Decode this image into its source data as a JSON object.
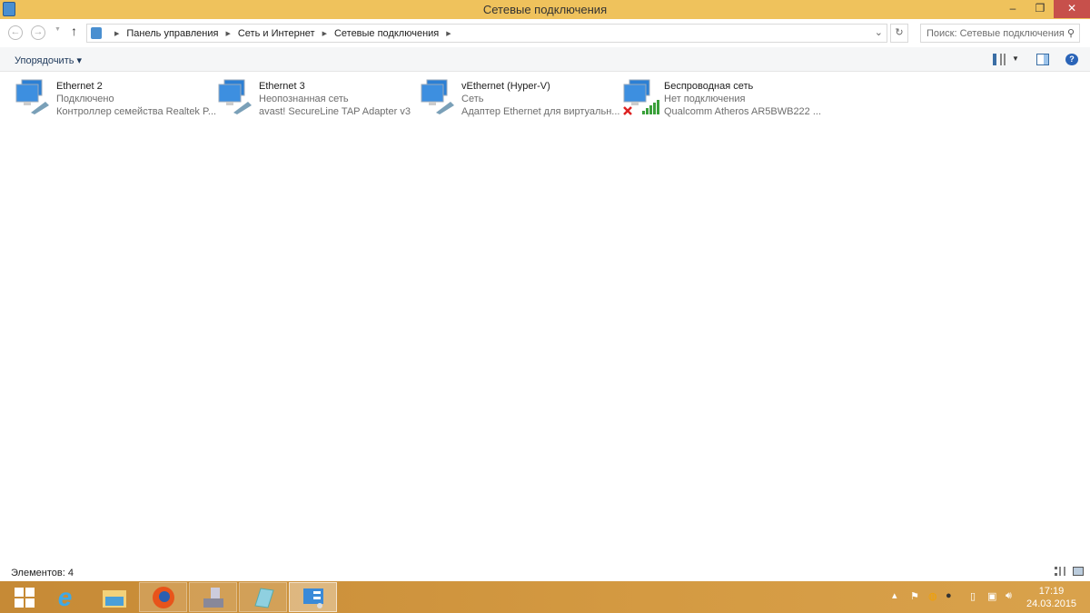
{
  "window": {
    "title": "Сетевые подключения",
    "minimize": "–",
    "maximize": "❐",
    "close": "✕"
  },
  "address": {
    "back": "←",
    "forward": "→",
    "up": "↑",
    "breadcrumb": [
      "Панель управления",
      "Сеть и Интернет",
      "Сетевые подключения"
    ],
    "search_placeholder": "Поиск: Сетевые подключения"
  },
  "toolbar": {
    "organize": "Упорядочить ▾"
  },
  "connections": [
    {
      "name": "Ethernet 2",
      "status": "Подключено",
      "adapter": "Контроллер семейства Realtek P...",
      "type": "wired"
    },
    {
      "name": "Ethernet 3",
      "status": "Неопознанная сеть",
      "adapter": "avast! SecureLine TAP Adapter v3",
      "type": "wired"
    },
    {
      "name": "vEthernet (Hyper-V)",
      "status": "Сеть",
      "adapter": "Адаптер Ethernet для виртуальн...",
      "type": "wired"
    },
    {
      "name": "Беспроводная сеть",
      "status": "Нет подключения",
      "adapter": "Qualcomm Atheros AR5BWB222 ...",
      "type": "wireless",
      "disconnected": true
    }
  ],
  "statusbar": {
    "count": "Элементов: 4"
  },
  "taskbar": {
    "apps": [
      "start",
      "internet-explorer",
      "file-explorer",
      "firefox",
      "device-manager",
      "notepad",
      "network-control-panel"
    ],
    "time": "17:19",
    "date": "24.03.2015"
  },
  "colors": {
    "titlebar": "#efc25c",
    "close": "#c7504b",
    "taskbar": "#d49a42"
  }
}
